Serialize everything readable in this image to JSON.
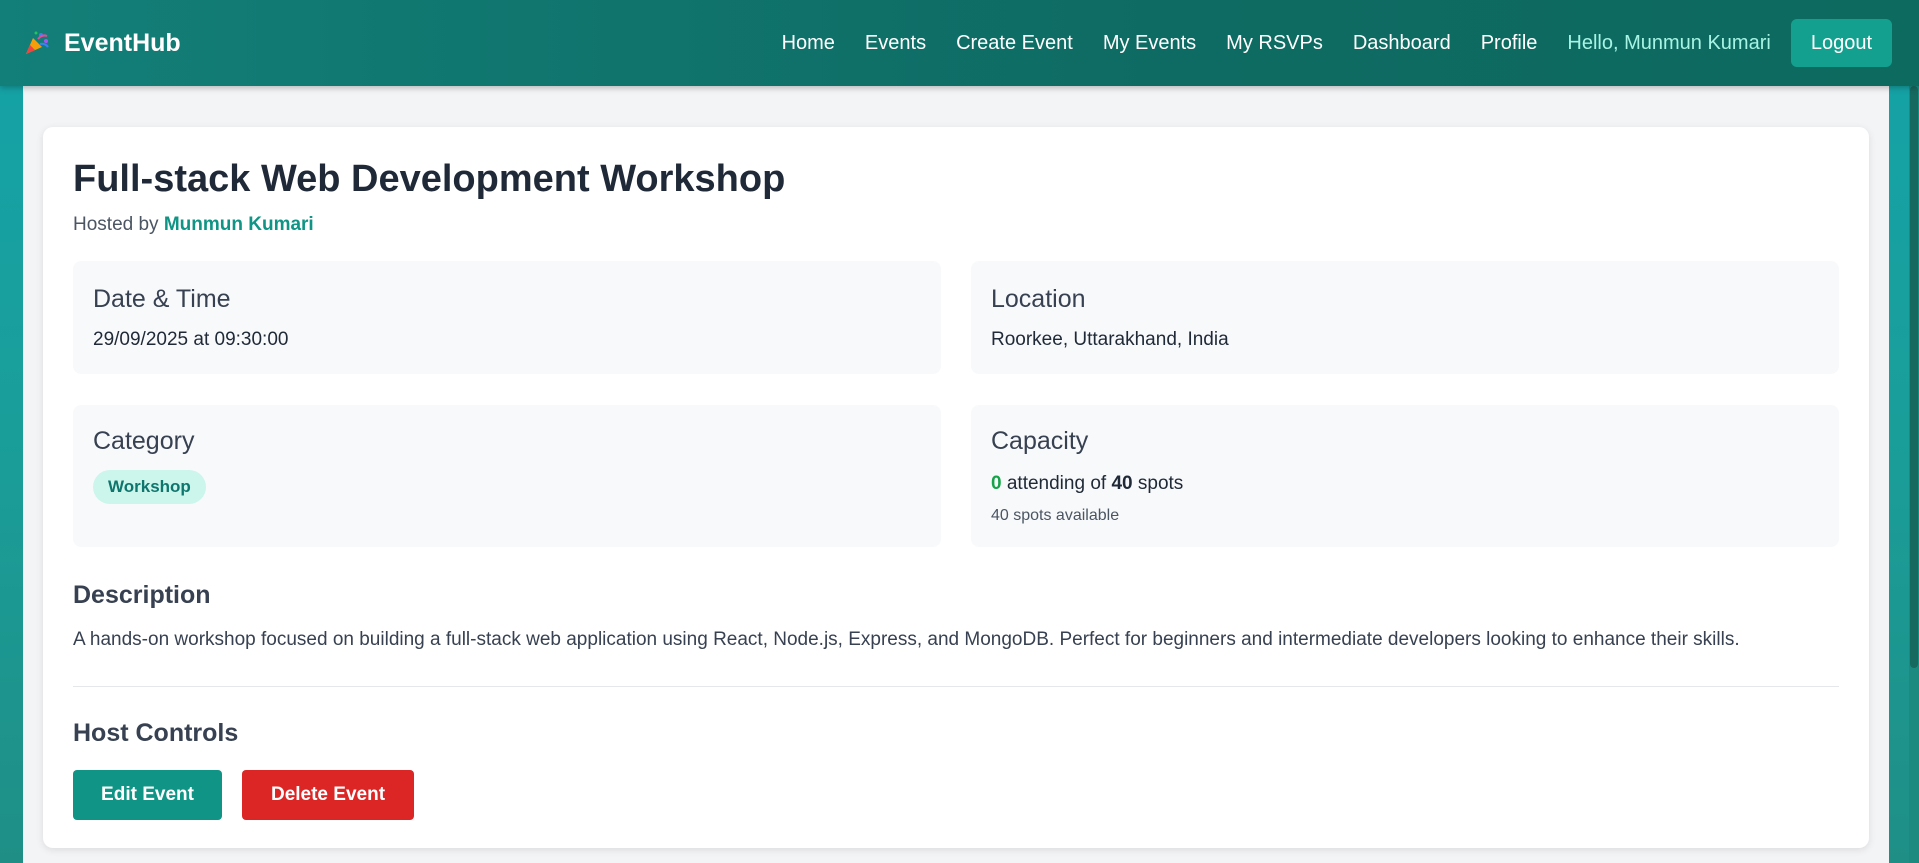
{
  "navbar": {
    "brand": "EventHub",
    "brand_icon": "party-popper-icon",
    "links": [
      "Home",
      "Events",
      "Create Event",
      "My Events",
      "My RSVPs",
      "Dashboard",
      "Profile"
    ],
    "greeting": "Hello, Munmun Kumari",
    "logout_label": "Logout"
  },
  "event": {
    "title": "Full-stack Web Development Workshop",
    "hosted_prefix": "Hosted by",
    "host_name": "Munmun Kumari",
    "date_title": "Date & Time",
    "date_value": "29/09/2025 at 09:30:00",
    "location_title": "Location",
    "location_value": "Roorkee, Uttarakhand, India",
    "category_title": "Category",
    "category_value": "Workshop",
    "capacity_title": "Capacity",
    "attending_count": "0",
    "attending_text": "attending of",
    "capacity_total": "40",
    "spots_word": "spots",
    "spots_available": "40 spots available",
    "description_title": "Description",
    "description": "A hands-on workshop focused on building a full-stack web application using React, Node.js, Express, and MongoDB. Perfect for beginners and intermediate developers looking to enhance their skills."
  },
  "host_controls": {
    "title": "Host Controls",
    "edit_label": "Edit Event",
    "delete_label": "Delete Event"
  },
  "colors": {
    "navbar": "#0e6b63",
    "accent": "#0f9485",
    "danger": "#dc2626",
    "attending": "#16a34a",
    "badge_bg": "#ccf5ec"
  }
}
